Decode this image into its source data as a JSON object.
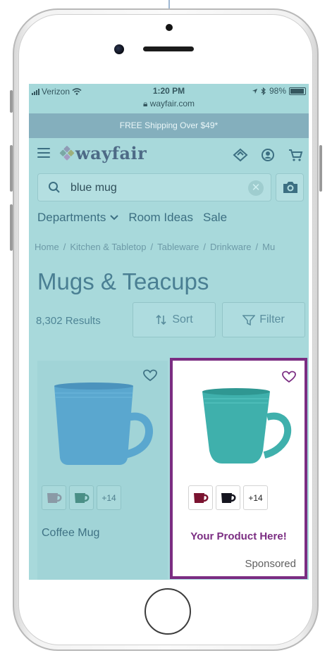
{
  "status_bar": {
    "carrier": "Verizon",
    "time": "1:20 PM",
    "url": "wayfair.com",
    "battery": "98%"
  },
  "promo_banner": "FREE Shipping Over $49*",
  "header": {
    "logo_text": "wayfair",
    "icons": [
      "menu-icon",
      "ideas-icon",
      "account-icon",
      "cart-icon"
    ]
  },
  "search": {
    "value": "blue mug",
    "icons": [
      "search-icon",
      "clear-icon",
      "camera-icon"
    ]
  },
  "nav": {
    "departments": "Departments",
    "room_ideas": "Room Ideas",
    "sale": "Sale"
  },
  "breadcrumb": [
    "Home",
    "Kitchen & Tabletop",
    "Tableware",
    "Drinkware",
    "Mu"
  ],
  "page": {
    "title": "Mugs & Teacups",
    "results": "8,302 Results",
    "sort_label": "Sort",
    "filter_label": "Filter"
  },
  "products": [
    {
      "name": "Coffee Mug",
      "more_colors": "+14",
      "mug_color": "#5aa7cf",
      "swatch_colors": [
        "#8a9aa6",
        "#4a8f86"
      ]
    },
    {
      "name": "Your Product Here!",
      "more_colors": "+14",
      "sponsored": "Sponsored",
      "mug_color": "#3fb0ac",
      "swatch_colors": [
        "#7a1330",
        "#15151f"
      ],
      "highlight_color": "#7b2d82"
    }
  ],
  "colors": {
    "overlay": "#a8d9db",
    "accent_purple": "#7b2d82",
    "promo_bg": "#84afbd"
  }
}
